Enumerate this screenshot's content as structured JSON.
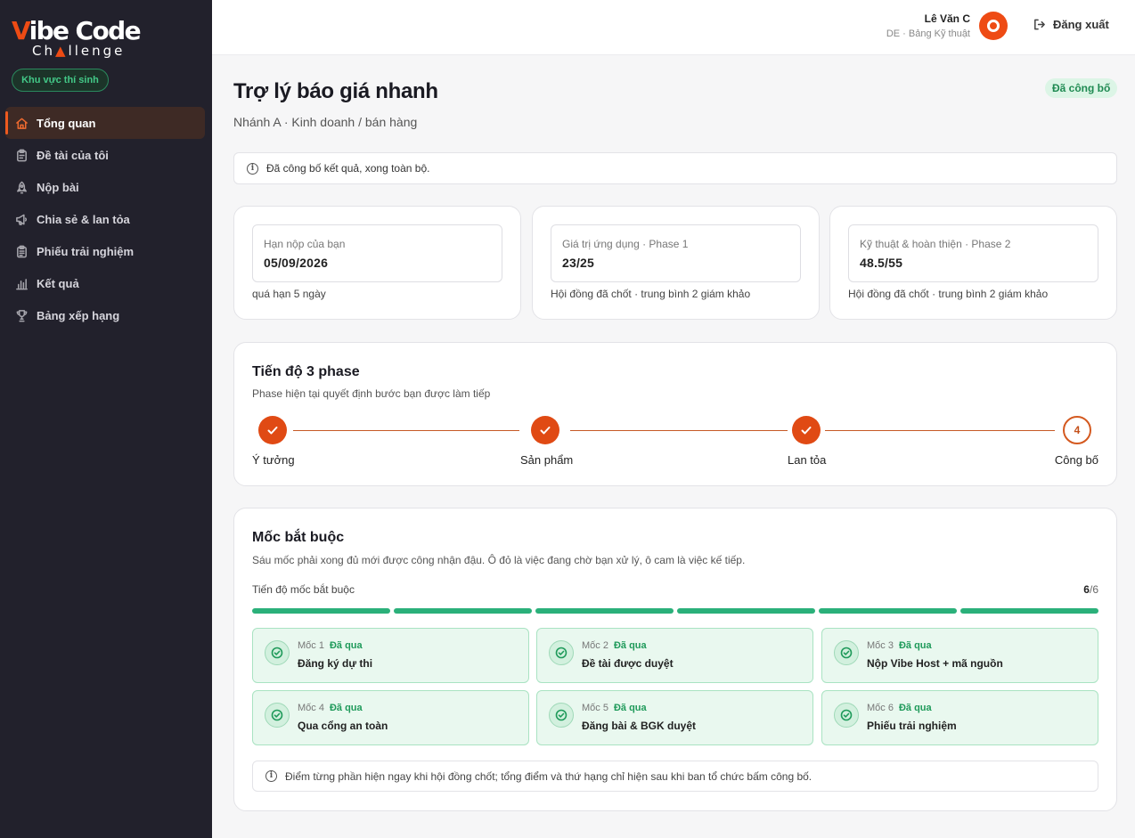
{
  "brand": {
    "logo_v": "V",
    "logo_rest": "ibe Code",
    "logo_sub_1": "Ch",
    "logo_sub_tri": "▲",
    "logo_sub_2": "llenge",
    "accent": "#ee4b14"
  },
  "sidebar": {
    "zone_label": "Khu vực thí sinh",
    "items": [
      {
        "label": "Tổng quan",
        "icon": "home-icon",
        "active": true
      },
      {
        "label": "Đề tài của tôi",
        "icon": "clipboard-icon"
      },
      {
        "label": "Nộp bài",
        "icon": "rocket-icon"
      },
      {
        "label": "Chia sẻ & lan tỏa",
        "icon": "megaphone-icon"
      },
      {
        "label": "Phiếu trải nghiệm",
        "icon": "clipboard-check-icon"
      },
      {
        "label": "Kết quả",
        "icon": "bar-chart-icon"
      },
      {
        "label": "Bảng xếp hạng",
        "icon": "trophy-icon"
      }
    ]
  },
  "header": {
    "user_name": "Lê Văn C",
    "user_role": "DE · Bảng Kỹ thuật",
    "logout_label": "Đăng xuất"
  },
  "page": {
    "title": "Trợ lý báo giá nhanh",
    "subtitle": "Nhánh A · Kinh doanh / bán hàng",
    "status_badge": "Đã công bố",
    "info_message": "Đã công bố kết quả, xong toàn bộ."
  },
  "stats": [
    {
      "label": "Hạn nộp của bạn",
      "value": "05/09/2026",
      "note": "quá hạn 5 ngày"
    },
    {
      "label": "Giá trị ứng dụng · Phase 1",
      "value": "23/25",
      "note": "Hội đồng đã chốt · trung bình 2 giám khảo"
    },
    {
      "label": "Kỹ thuật & hoàn thiện · Phase 2",
      "value": "48.5/55",
      "note": "Hội đồng đã chốt · trung bình 2 giám khảo"
    }
  ],
  "phases": {
    "title": "Tiến độ 3 phase",
    "subtitle": "Phase hiện tại quyết định bước bạn được làm tiếp",
    "steps": [
      {
        "label": "Ý tưởng",
        "done": true
      },
      {
        "label": "Sản phẩm",
        "done": true
      },
      {
        "label": "Lan tỏa",
        "done": true
      },
      {
        "label": "Công bố",
        "done": false,
        "number": "4"
      }
    ]
  },
  "milestones": {
    "title": "Mốc bắt buộc",
    "subtitle": "Sáu mốc phải xong đủ mới được công nhận đậu. Ô đỏ là việc đang chờ bạn xử lý, ô cam là việc kế tiếp.",
    "progress_label": "Tiến độ mốc bắt buộc",
    "progress_done": "6",
    "progress_total": "/6",
    "items": [
      {
        "label": "Mốc 1",
        "status": "Đã qua",
        "name": "Đăng ký dự thi"
      },
      {
        "label": "Mốc 2",
        "status": "Đã qua",
        "name": "Đề tài được duyệt"
      },
      {
        "label": "Mốc 3",
        "status": "Đã qua",
        "name": "Nộp Vibe Host + mã nguồn"
      },
      {
        "label": "Mốc 4",
        "status": "Đã qua",
        "name": "Qua cổng an toàn"
      },
      {
        "label": "Mốc 5",
        "status": "Đã qua",
        "name": "Đăng bài & BGK duyệt"
      },
      {
        "label": "Mốc 6",
        "status": "Đã qua",
        "name": "Phiếu trải nghiệm"
      }
    ],
    "footnote": "Điểm từng phần hiện ngay khi hội đồng chốt; tổng điểm và thứ hạng chỉ hiện sau khi ban tổ chức bấm công bố."
  }
}
